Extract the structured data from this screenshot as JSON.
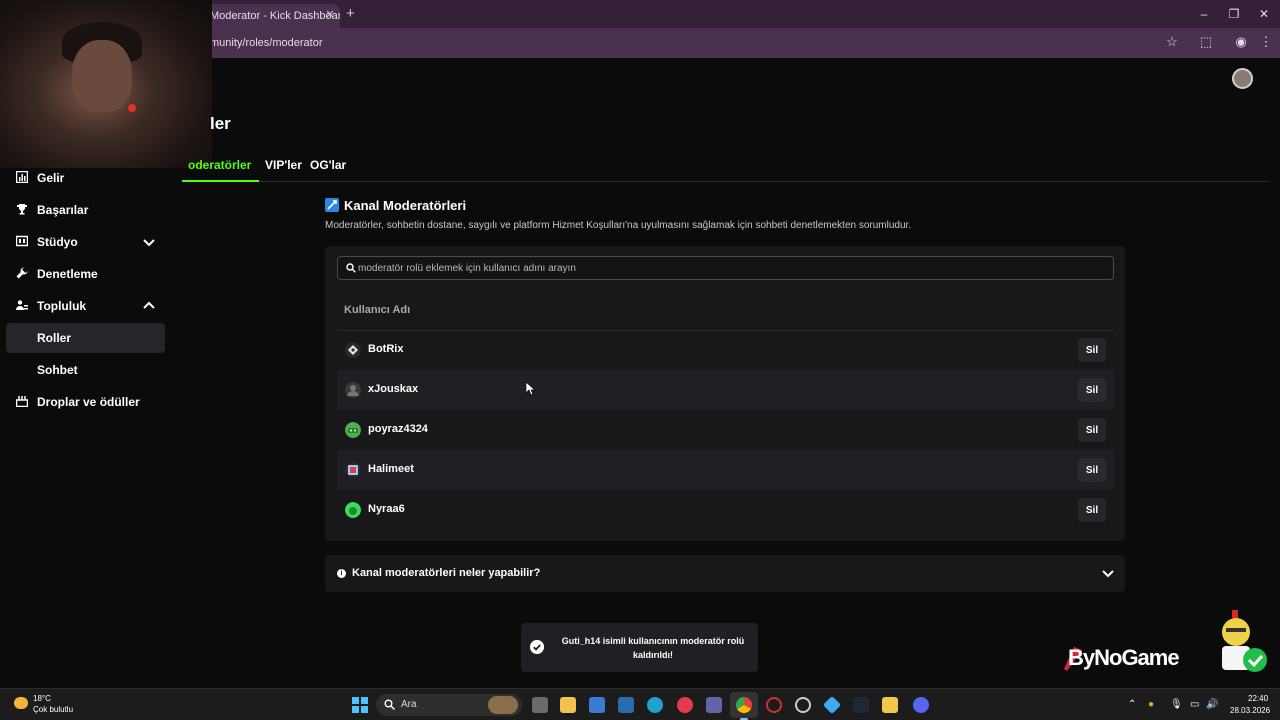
{
  "browser": {
    "tab_title": "Moderator - Kick Dashboard",
    "tab_close": "✕",
    "new_tab": "+",
    "url": "munity/roles/moderator"
  },
  "page": {
    "title": "ler",
    "tabs": [
      "oderatörler",
      "VIP'ler",
      "OG'lar"
    ]
  },
  "sidebar": {
    "items": [
      {
        "label": "Gelir",
        "icon": "bar-chart-icon"
      },
      {
        "label": "Başarılar",
        "icon": "trophy-icon"
      },
      {
        "label": "Stüdyo",
        "icon": "studio-icon"
      },
      {
        "label": "Denetleme",
        "icon": "wrench-icon"
      },
      {
        "label": "Topluluk",
        "icon": "community-icon"
      },
      {
        "label": "Roller"
      },
      {
        "label": "Sohbet"
      },
      {
        "label": "Droplar ve ödüller",
        "icon": "drops-icon"
      }
    ]
  },
  "main": {
    "section_title": "Kanal Moderatörleri",
    "section_desc": "Moderatörler, sohbetin dostane, saygılı ve platform Hizmet Koşulları'na uyulmasını sağlamak için sohbeti denetlemekten sorumludur.",
    "search_placeholder": "moderatör rolü eklemek için kullanıcı adını arayın",
    "column_header": "Kullanıcı Adı",
    "remove_label": "Sil",
    "users": [
      {
        "name": "BotRix",
        "avatar_color": "#e8e8e8"
      },
      {
        "name": "xJouskax",
        "avatar_color": "#3a3a3a"
      },
      {
        "name": "poyraz4324",
        "avatar_color": "#4caf50"
      },
      {
        "name": "Halimeet",
        "avatar_color": "#9ec6ff"
      },
      {
        "name": "Nyraa6",
        "avatar_color": "#3ddc5a"
      }
    ],
    "faq": "Kanal moderatörleri neler yapabilir?"
  },
  "toast": {
    "message": "Guti_h14 isimli kullanıcının moderatör rolü kaldırıldı!"
  },
  "watermark": "ByNoGame",
  "taskbar": {
    "weather_temp": "18°C",
    "weather_desc": "Çok bulutlu",
    "search_label": "Ara",
    "time": "22:40",
    "date": "28.03.2026"
  },
  "colors": {
    "accent": "#53fc18",
    "browser_frame": "#35203a",
    "page_bg": "#0b0b0c",
    "panel_bg": "#18181b"
  }
}
